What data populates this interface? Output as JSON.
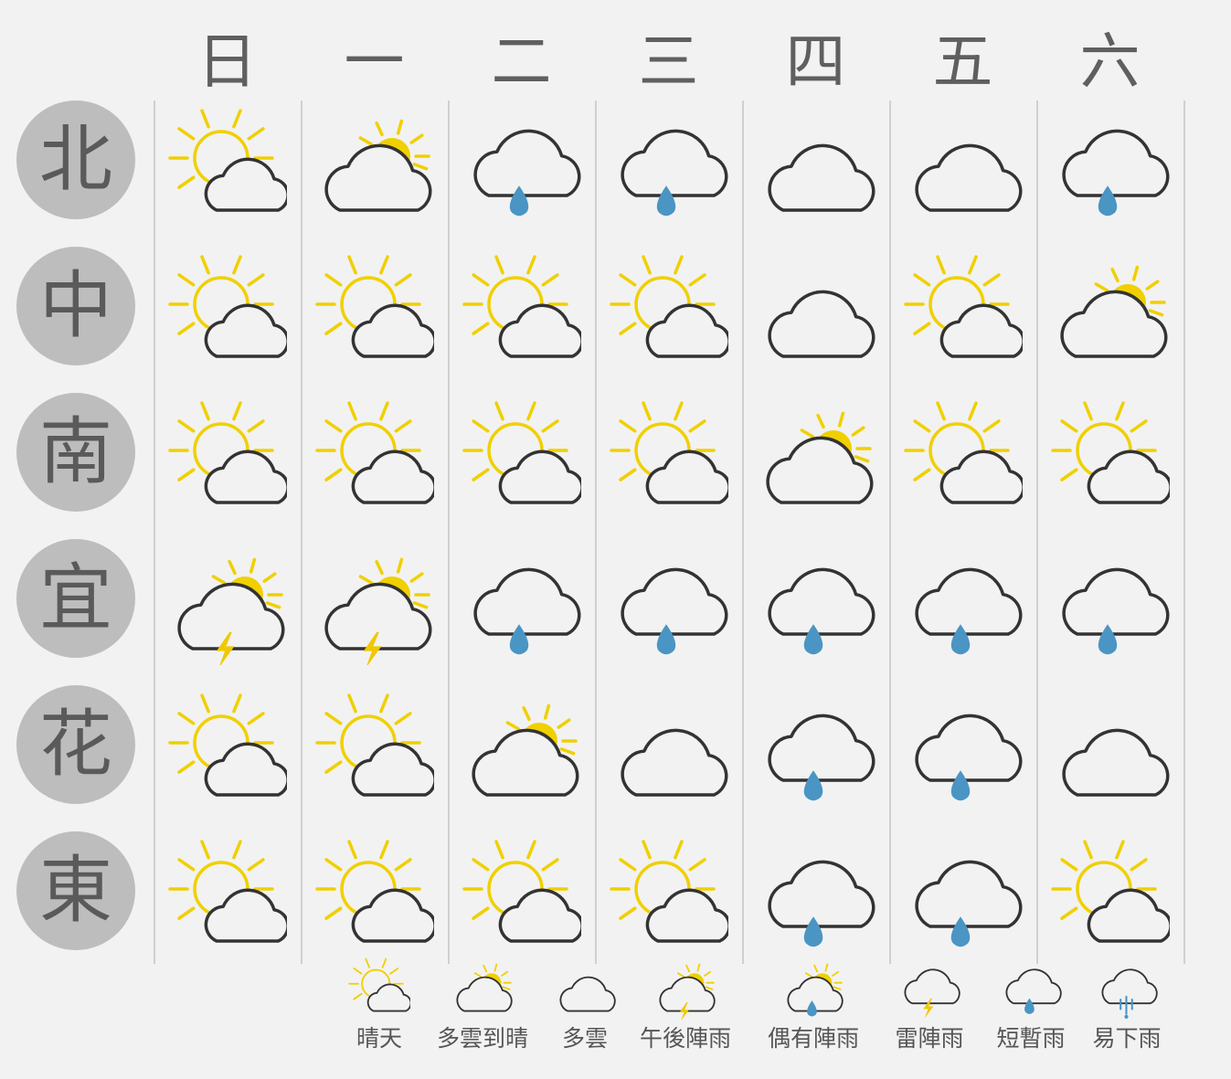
{
  "colors": {
    "background": "#f2f2f2",
    "sun": "#f0d000",
    "cloud_stroke": "#333333",
    "raindrop": "#4a95c4",
    "lightning": "#f0c800",
    "region_circle": "#bdbdbd",
    "region_text": "#5a5a5a",
    "header_text": "#5f5f5f"
  },
  "days": [
    "日",
    "一",
    "二",
    "三",
    "四",
    "五",
    "六"
  ],
  "regions": [
    {
      "name": "北",
      "forecast": [
        "sunny",
        "cloudy-to-sunny",
        "short-rain",
        "short-rain",
        "cloudy",
        "cloudy",
        "short-rain"
      ]
    },
    {
      "name": "中",
      "forecast": [
        "sunny",
        "sunny",
        "sunny",
        "sunny",
        "cloudy",
        "sunny",
        "cloudy-to-sunny"
      ]
    },
    {
      "name": "南",
      "forecast": [
        "sunny",
        "sunny",
        "sunny",
        "sunny",
        "cloudy-to-sunny",
        "sunny",
        "sunny"
      ]
    },
    {
      "name": "宜",
      "forecast": [
        "afternoon-thunder",
        "afternoon-thunder",
        "short-rain",
        "short-rain",
        "short-rain",
        "short-rain",
        "short-rain"
      ]
    },
    {
      "name": "花",
      "forecast": [
        "sunny",
        "sunny",
        "cloudy-to-sunny",
        "cloudy",
        "short-rain",
        "short-rain",
        "cloudy"
      ]
    },
    {
      "name": "東",
      "forecast": [
        "sunny",
        "sunny",
        "sunny",
        "sunny",
        "short-rain",
        "short-rain",
        "sunny"
      ]
    }
  ],
  "legend": [
    {
      "icon": "sunny",
      "label": "晴天"
    },
    {
      "icon": "cloudy-to-sunny",
      "label": "多雲到晴"
    },
    {
      "icon": "cloudy",
      "label": "多雲"
    },
    {
      "icon": "afternoon-thunder",
      "label": "午後陣雨"
    },
    {
      "icon": "occasional-showers",
      "label": "偶有陣雨"
    },
    {
      "icon": "thunder-showers",
      "label": "雷陣雨"
    },
    {
      "icon": "short-rain",
      "label": "短暫雨"
    },
    {
      "icon": "heavy-rain",
      "label": "易下雨"
    }
  ]
}
